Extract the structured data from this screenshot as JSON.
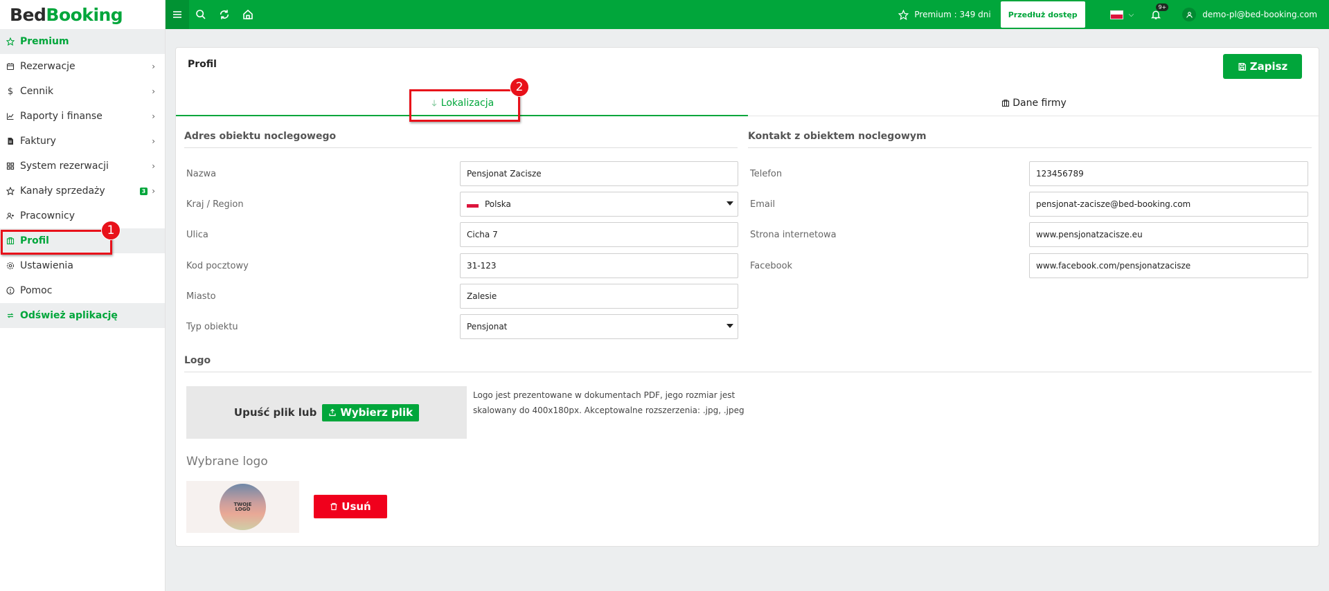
{
  "brand": {
    "part1": "Bed",
    "part2": "Booking"
  },
  "sidebar": {
    "premium": "Premium",
    "items": [
      {
        "label": "Rezerwacje",
        "icon": "calendar-icon"
      },
      {
        "label": "Cennik",
        "icon": "dollar-icon"
      },
      {
        "label": "Raporty i finanse",
        "icon": "chart-icon"
      },
      {
        "label": "Faktury",
        "icon": "invoice-icon"
      },
      {
        "label": "System rezerwacji",
        "icon": "grid-icon"
      },
      {
        "label": "Kanały sprzedaży",
        "icon": "star-icon",
        "badge": "3"
      },
      {
        "label": "Pracownicy",
        "icon": "user-plus-icon"
      },
      {
        "label": "Profil",
        "icon": "building-icon"
      },
      {
        "label": "Ustawienia",
        "icon": "gear-icon"
      },
      {
        "label": "Pomoc",
        "icon": "info-icon"
      }
    ],
    "refresh": "Odśwież aplikację"
  },
  "topbar": {
    "premium_text": "Premium : 349 dni",
    "extend_button": "Przedłuż dostęp",
    "notifications_count": "9+",
    "user_email": "demo-pl@bed-booking.com"
  },
  "page": {
    "title": "Profil",
    "save_button": "Zapisz",
    "tabs": [
      "Lokalizacja",
      "Dane firmy"
    ]
  },
  "address": {
    "heading": "Adres obiektu noclegowego",
    "fields": [
      {
        "label": "Nazwa",
        "value": "Pensjonat Zacisze"
      },
      {
        "label": "Kraj / Region",
        "value": "Polska"
      },
      {
        "label": "Ulica",
        "value": "Cicha 7"
      },
      {
        "label": "Kod pocztowy",
        "value": "31-123"
      },
      {
        "label": "Miasto",
        "value": "Zalesie"
      },
      {
        "label": "Typ obiektu",
        "value": "Pensjonat"
      }
    ]
  },
  "contact": {
    "heading": "Kontakt z obiektem noclegowym",
    "fields": [
      {
        "label": "Telefon",
        "value": "123456789"
      },
      {
        "label": "Email",
        "value": "pensjonat-zacisze@bed-booking.com"
      },
      {
        "label": "Strona internetowa",
        "value": "www.pensjonatzacisze.eu"
      },
      {
        "label": "Facebook",
        "value": "www.facebook.com/pensjonatzacisze"
      }
    ]
  },
  "logo": {
    "heading": "Logo",
    "drop_text": "Upuść plik lub",
    "choose_button": "Wybierz plik",
    "info_line1": "Logo jest prezentowane w dokumentach PDF, jego rozmiar jest",
    "info_line2": "skalowany do 400x180px. Akceptowalne rozszerzenia: .jpg, .jpeg",
    "chosen_title": "Wybrane logo",
    "placeholder_text_1": "TWOJE",
    "placeholder_text_2": "LOGO",
    "delete_button": "Usuń"
  },
  "annotations": [
    "1",
    "2"
  ],
  "colors": {
    "accent": "#01a63b",
    "danger": "#f0001c",
    "annotation": "#e8111a"
  }
}
